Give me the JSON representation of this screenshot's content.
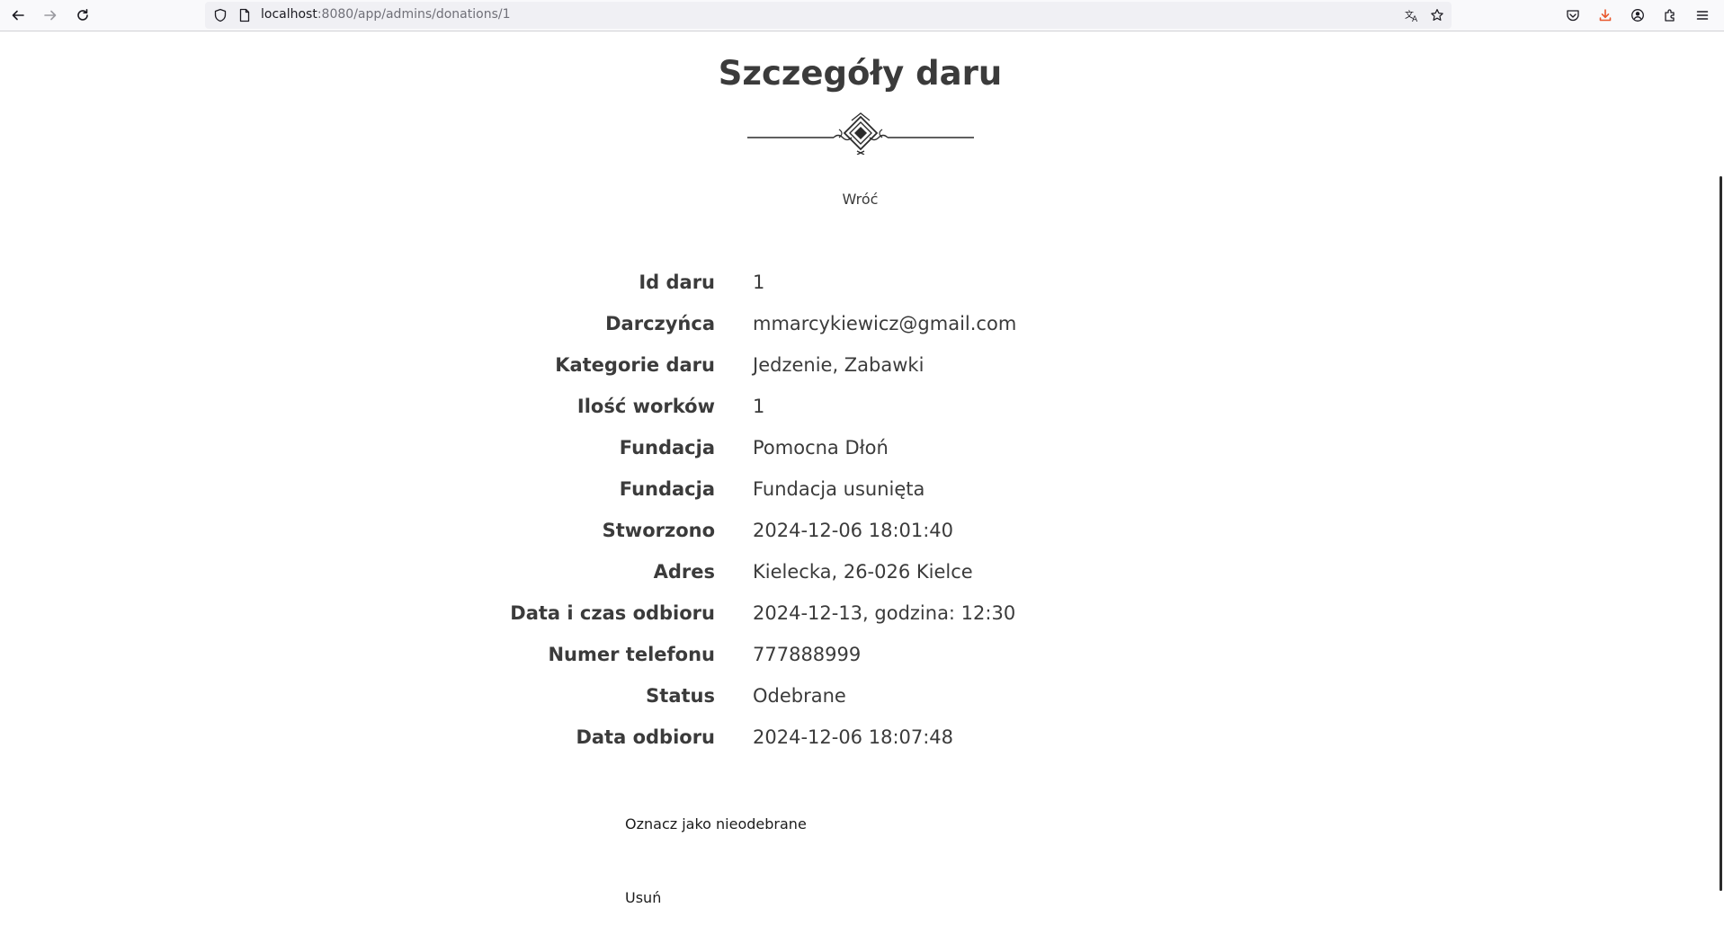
{
  "browser": {
    "url_host": "localhost",
    "url_rest": ":8080/app/admins/donations/1",
    "icons": {
      "back": "arrow-left-icon",
      "forward": "arrow-right-icon",
      "reload": "reload-icon",
      "shield": "shield-icon",
      "page": "page-icon",
      "translate": "translate-icon",
      "bookmark": "star-icon",
      "pocket": "pocket-icon",
      "downloads": "download-icon",
      "account": "account-icon",
      "extensions": "puzzle-icon",
      "menu": "hamburger-menu-icon"
    },
    "download_accent": "#e8582d"
  },
  "page": {
    "title": "Szczegóły daru",
    "back_label": "Wróć",
    "details": [
      {
        "label": "Id daru",
        "value": "1"
      },
      {
        "label": "Darczyńca",
        "value": "mmarcykiewicz@gmail.com"
      },
      {
        "label": "Kategorie daru",
        "value": "Jedzenie, Zabawki"
      },
      {
        "label": "Ilość worków",
        "value": "1"
      },
      {
        "label": "Fundacja",
        "value": "Pomocna Dłoń"
      },
      {
        "label": "Fundacja",
        "value": "Fundacja usunięta"
      },
      {
        "label": "Stworzono",
        "value": "2024-12-06 18:01:40"
      },
      {
        "label": "Adres",
        "value": "Kielecka, 26-026 Kielce"
      },
      {
        "label": "Data i czas odbioru",
        "value": "2024-12-13, godzina: 12:30"
      },
      {
        "label": "Numer telefonu",
        "value": "777888999"
      },
      {
        "label": "Status",
        "value": "Odebrane"
      },
      {
        "label": "Data odbioru",
        "value": "2024-12-06 18:07:48"
      }
    ],
    "actions": {
      "mark_uncollected": "Oznacz jako nieodebrane",
      "delete": "Usuń"
    }
  }
}
